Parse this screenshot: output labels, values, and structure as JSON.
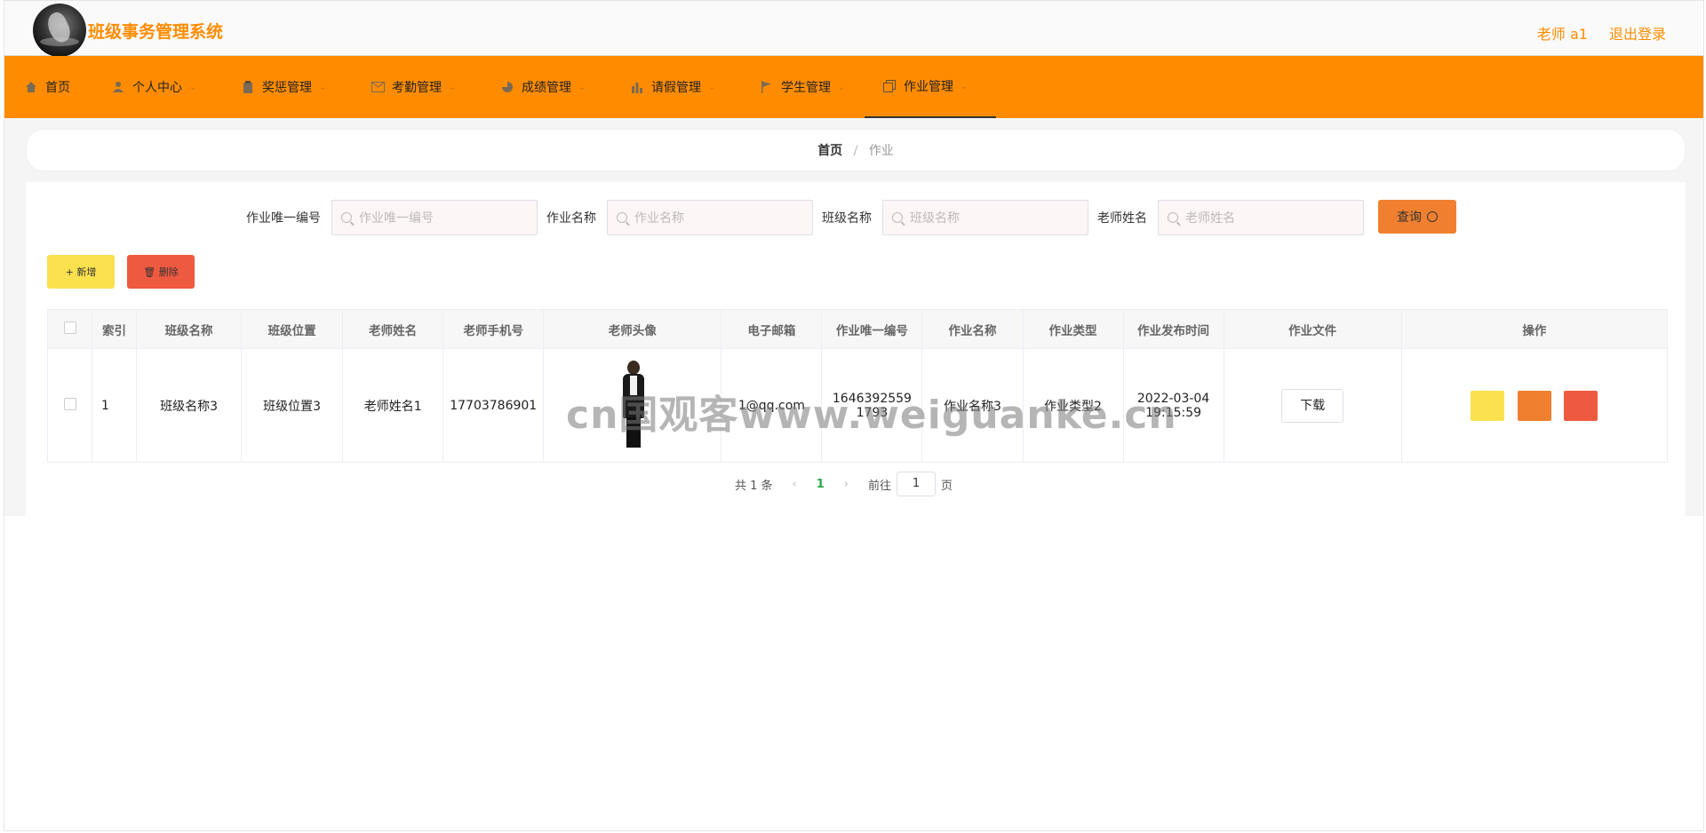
{
  "header": {
    "app_title": "班级事务管理系统",
    "user_label": "老师 a1",
    "logout_label": "退出登录",
    "accent_color": "#ff8c00"
  },
  "nav": {
    "items": [
      {
        "label": "首页",
        "icon": "home-icon"
      },
      {
        "label": "个人中心",
        "icon": "user-icon"
      },
      {
        "label": "奖惩管理",
        "icon": "clipboard-icon"
      },
      {
        "label": "考勤管理",
        "icon": "mail-icon"
      },
      {
        "label": "成绩管理",
        "icon": "chart-pie-icon"
      },
      {
        "label": "请假管理",
        "icon": "bar-chart-icon"
      },
      {
        "label": "学生管理",
        "icon": "flag-icon"
      },
      {
        "label": "作业管理",
        "icon": "copy-icon"
      }
    ],
    "active_index": 7
  },
  "breadcrumb": {
    "home": "首页",
    "separator": "/",
    "current": "作业"
  },
  "search": {
    "fields": [
      {
        "label": "作业唯一编号",
        "placeholder": "作业唯一编号"
      },
      {
        "label": "作业名称",
        "placeholder": "作业名称"
      },
      {
        "label": "班级名称",
        "placeholder": "班级名称"
      },
      {
        "label": "老师姓名",
        "placeholder": "老师姓名"
      }
    ],
    "query_label": "查询"
  },
  "actions": {
    "add_label": "+ 新增",
    "delete_label": "🗑 删除"
  },
  "table": {
    "columns": [
      "索引",
      "班级名称",
      "班级位置",
      "老师姓名",
      "老师手机号",
      "老师头像",
      "电子邮箱",
      "作业唯一编号",
      "作业名称",
      "作业类型",
      "作业发布时间",
      "作业文件",
      "操作"
    ],
    "rows": [
      {
        "index": "1",
        "class_name": "班级名称3",
        "class_location": "班级位置3",
        "teacher_name": "老师姓名1",
        "teacher_phone": "17703786901",
        "email": "1@qq.com",
        "homework_id": "16463925591793",
        "homework_name": "作业名称3",
        "homework_type": "作业类型2",
        "publish_time": "2022-03-04 19:15:59",
        "file_button": "下载"
      }
    ]
  },
  "pagination": {
    "total": "共 1 条",
    "current": "1",
    "goto_prefix": "前往",
    "goto_value": "1",
    "goto_suffix": "页"
  },
  "watermark": "cn国观客www.weiguanke.cn"
}
